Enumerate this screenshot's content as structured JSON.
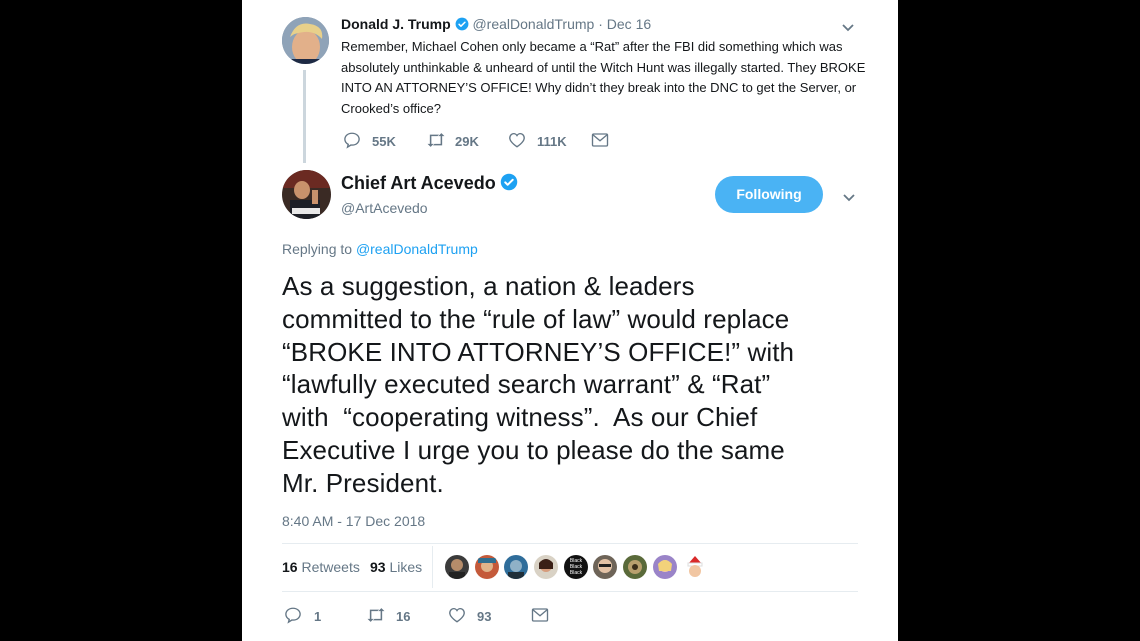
{
  "tweet1": {
    "name": "Donald J. Trump",
    "handle": "@realDonaldTrump",
    "date_sep": "·",
    "date": "Dec 16",
    "text": "Remember, Michael Cohen only became a “Rat” after the FBI did something which was absolutely unthinkable & unheard of until the Witch Hunt was illegally started. They BROKE INTO AN ATTORNEY’S OFFICE! Why didn’t they break into the DNC to get the Server, or Crooked’s office?",
    "replies": "55K",
    "retweets": "29K",
    "likes": "111K"
  },
  "tweet2": {
    "name": "Chief Art Acevedo",
    "handle": "@ArtAcevedo",
    "follow_label": "Following",
    "replying_prefix": "Replying to",
    "replying_to": "@realDonaldTrump",
    "text_lines": [
      "As a suggestion, a nation & leaders",
      "committed to the “rule of law” would replace",
      "“BROKE INTO ATTORNEY’S OFFICE!” with",
      "“lawfully executed search warrant” & “Rat”",
      "with  “cooperating witness”.  As our Chief",
      "Executive I urge you to please do the same",
      "Mr. President."
    ],
    "timestamp": "8:40 AM - 17 Dec 2018",
    "retweet_count": "16",
    "retweet_label": "Retweets",
    "like_count": "93",
    "like_label": "Likes",
    "mini_avatar_text": "Black Black Black",
    "actions": {
      "replies": "1",
      "retweets": "16",
      "likes": "93"
    }
  },
  "colors": {
    "accent": "#1da1f2",
    "follow_bg": "#4ab3f4",
    "muted": "#657786",
    "verified": "#1da1f2"
  },
  "icons": [
    "verified-badge-icon",
    "chevron-down-icon",
    "reply-icon",
    "retweet-icon",
    "heart-icon",
    "envelope-icon"
  ]
}
